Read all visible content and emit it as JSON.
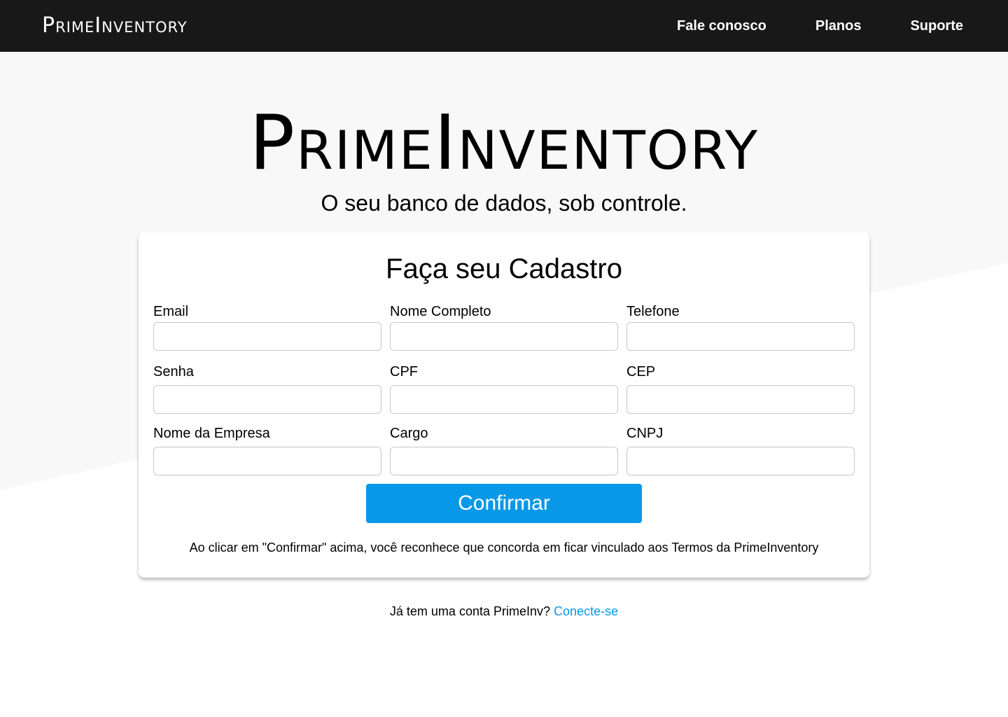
{
  "colors": {
    "topbar_bg": "#181818",
    "page_bg_shape": "#f8f8f8",
    "accent": "#0798e8"
  },
  "header": {
    "logo": "PrimeInventory",
    "nav": [
      {
        "label": "Fale conosco"
      },
      {
        "label": "Planos"
      },
      {
        "label": "Suporte"
      }
    ]
  },
  "hero": {
    "title": "PrimeInventory",
    "subtitle": "O seu banco de dados, sob controle."
  },
  "form": {
    "title": "Faça seu Cadastro",
    "fields": {
      "email": {
        "label": "Email",
        "value": ""
      },
      "nome_completo": {
        "label": "Nome Completo",
        "value": ""
      },
      "telefone": {
        "label": "Telefone",
        "value": ""
      },
      "senha": {
        "label": "Senha",
        "value": ""
      },
      "cpf": {
        "label": "CPF",
        "value": ""
      },
      "cep": {
        "label": "CEP",
        "value": ""
      },
      "nome_empresa": {
        "label": "Nome da Empresa",
        "value": ""
      },
      "cargo": {
        "label": "Cargo",
        "value": ""
      },
      "cnpj": {
        "label": "CNPJ",
        "value": ""
      }
    },
    "confirm_label": "Confirmar",
    "terms_text": "Ao clicar em \"Confirmar\" acima, você reconhece que concorda em ficar vinculado aos Termos da PrimeInventory"
  },
  "login": {
    "prompt": "Já tem uma conta PrimeInv?",
    "link_label": "Conecte-se"
  }
}
